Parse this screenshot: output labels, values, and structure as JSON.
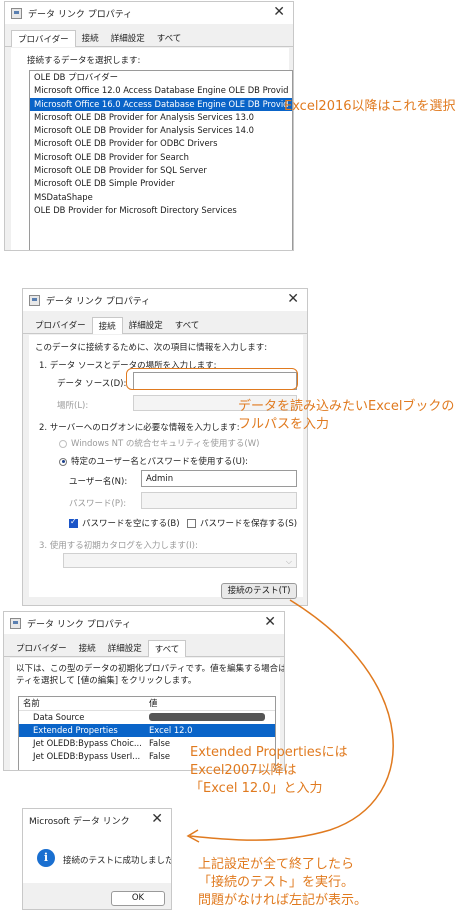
{
  "dialog1": {
    "title": "データ リンク プロパティ",
    "tabs": [
      "プロバイダー",
      "接続",
      "詳細設定",
      "すべて"
    ],
    "list_label": "接続するデータを選択します:",
    "providers": [
      "OLE DB プロバイダー",
      "Microsoft Office 12.0 Access Database Engine OLE DB Provid",
      "Microsoft Office 16.0 Access Database Engine OLE DB Provid",
      "Microsoft OLE DB Provider for Analysis Services 13.0",
      "Microsoft OLE DB Provider for Analysis Services 14.0",
      "Microsoft OLE DB Provider for ODBC Drivers",
      "Microsoft OLE DB Provider for Search",
      "Microsoft OLE DB Provider for SQL Server",
      "Microsoft OLE DB Simple Provider",
      "MSDataShape",
      "OLE DB Provider for Microsoft Directory Services"
    ],
    "annotation": "Excel2016以降はこれを選択"
  },
  "dialog2": {
    "title": "データ リンク プロパティ",
    "tabs": [
      "プロバイダー",
      "接続",
      "詳細設定",
      "すべて"
    ],
    "intro": "このデータに接続するために、次の項目に情報を入力します:",
    "step1": "1. データ ソースとデータの場所を入力します:",
    "datasource_label": "データ ソース(D):",
    "datasource_value": "",
    "location_label": "場所(L):",
    "step2": "2. サーバーへのログオンに必要な情報を入力します:",
    "windows_nt": "Windows NT の統合セキュリティを使用する(W)",
    "specific_user": "特定のユーザー名とパスワードを使用する(U):",
    "username_label": "ユーザー名(N):",
    "username_value": "Admin",
    "password_label": "パスワード(P):",
    "blank_password": "パスワードを空にする(B)",
    "save_password": "パスワードを保存する(S)",
    "step3": "3. 使用する初期カタログを入力します(I):",
    "test_button": "接続のテスト(T)",
    "annotation_line1": "データを読み込みたいExcelブックの",
    "annotation_line2": "フルパスを入力"
  },
  "dialog3": {
    "title": "データ リンク プロパティ",
    "tabs": [
      "プロバイダー",
      "接続",
      "詳細設定",
      "すべて"
    ],
    "intro_line1": "以下は、この型のデータの初期化プロパティです。値を編集する場合は、プロパ",
    "intro_line2": "ティを選択して [値の編集] をクリックします。",
    "col_name": "名前",
    "col_value": "値",
    "rows": [
      {
        "name": "Data Source",
        "value": ""
      },
      {
        "name": "Extended Properties",
        "value": "Excel 12.0"
      },
      {
        "name": "Jet OLEDB:Bypass Choic...",
        "value": "False"
      },
      {
        "name": "Jet OLEDB:Bypass UserI...",
        "value": "False"
      }
    ],
    "annotation_line1": "Extended Propertiesには",
    "annotation_line2": "Excel2007以降は",
    "annotation_line3": "「Excel 12.0」と入力"
  },
  "dialog4": {
    "title": "Microsoft データ リンク",
    "message": "接続のテストに成功しました。",
    "ok_button": "OK",
    "annotation_line1": "上記設定が全て終了したら",
    "annotation_line2": "「接続のテスト」を実行。",
    "annotation_line3": "問題がなければ左記が表示。"
  },
  "colors": {
    "annotation": "#e07a1f",
    "selection": "#0a64c8"
  }
}
